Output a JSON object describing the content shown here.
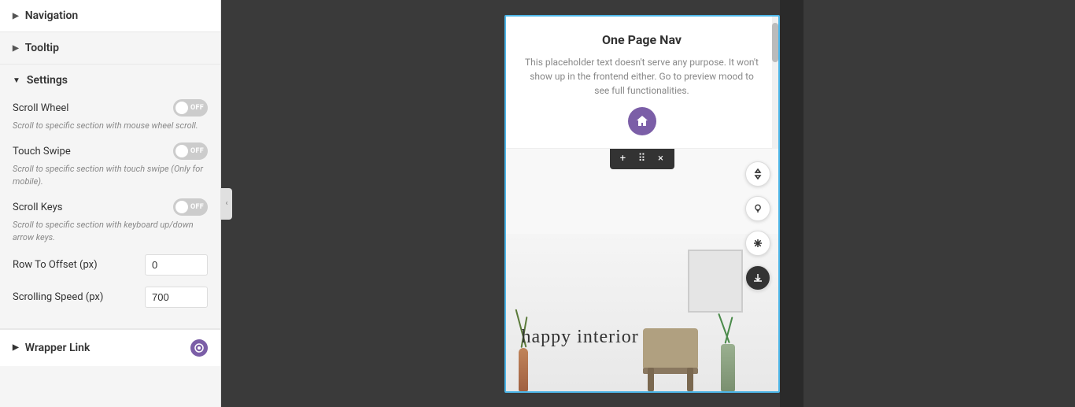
{
  "sidebar": {
    "navigation_label": "Navigation",
    "tooltip_label": "Tooltip",
    "settings_label": "Settings",
    "scroll_wheel": {
      "label": "Scroll Wheel",
      "description": "Scroll to specific section with mouse wheel scroll.",
      "value": "OFF"
    },
    "touch_swipe": {
      "label": "Touch Swipe",
      "description": "Scroll to specific section with touch swipe (Only for mobile).",
      "value": "OFF"
    },
    "scroll_keys": {
      "label": "Scroll Keys",
      "description": "Scroll to specific section with keyboard up/down arrow keys.",
      "value": "OFF"
    },
    "row_to_offset": {
      "label": "Row To Offset (px)",
      "value": "0"
    },
    "scrolling_speed": {
      "label": "Scrolling Speed (px)",
      "value": "700"
    },
    "wrapper_link_label": "Wrapper Link"
  },
  "preview": {
    "widget_title": "One Page Nav",
    "widget_description": "This placeholder text doesn't serve any purpose. It won't show up in the frontend either. Go to preview mood to see full functionalities.",
    "interior_text": "happy interior",
    "toolbar": {
      "add": "+",
      "move": "⠿",
      "close": "×"
    }
  }
}
